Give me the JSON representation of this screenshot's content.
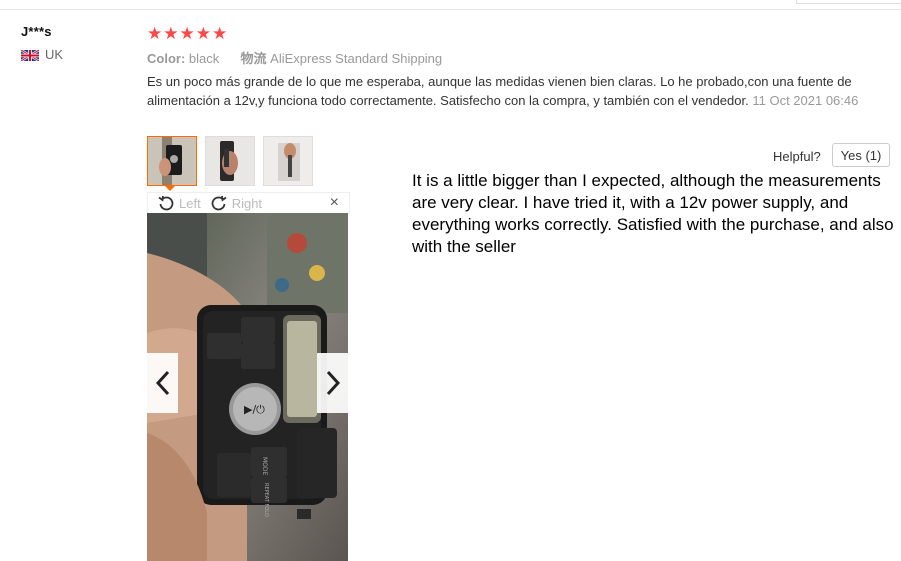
{
  "reviewer": {
    "name": "J***s",
    "country": "UK",
    "flag_icon": "uk-flag-icon"
  },
  "review": {
    "stars": 5,
    "star_color": "#ff4747",
    "color_label": "Color:",
    "color_value": "black",
    "shipping_label": "物流",
    "shipping_value": "AliExpress Standard Shipping",
    "text": "Es un poco más grande de lo que me esperaba, aunque las medidas vienen bien claras. Lo he probado,con una fuente de alimentación a 12v,y funciona todo correctamente. Satisfecho con la compra, y también con el vendedor.",
    "date": "11 Oct 2021 06:46"
  },
  "viewer": {
    "rotate_left_label": "Left",
    "rotate_right_label": "Right",
    "close_label": "×",
    "thumbnail_count": 3,
    "active_thumbnail": 1
  },
  "device": {
    "button_mode": "MODE",
    "button_repeat": "REPEAT FOLD",
    "button_play": "▶/⏻"
  },
  "helpful": {
    "label": "Helpful?",
    "yes_label": "Yes (1)"
  },
  "translation": {
    "text": "It is a little bigger than I expected, although the measurements are very clear. I have tried it, with a 12v power supply, and everything works correctly. Satisfied with the purchase, and also with the seller"
  },
  "colors": {
    "accent": "#ff6a00",
    "star": "#ff4747"
  }
}
